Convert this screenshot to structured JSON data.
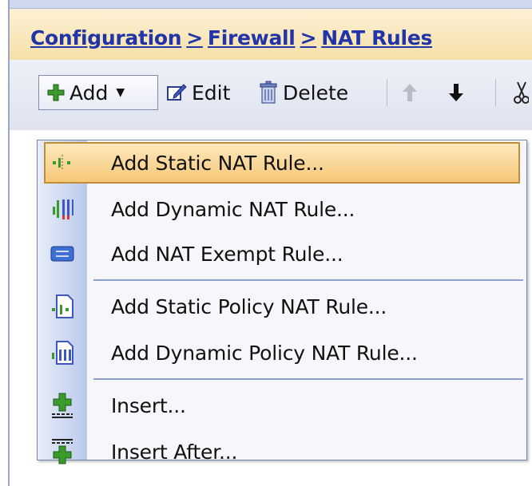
{
  "breadcrumb": [
    "Configuration",
    "Firewall",
    "NAT Rules"
  ],
  "breadcrumb_sep": ">",
  "toolbar": {
    "add_label": "Add",
    "edit_label": "Edit",
    "delete_label": "Delete"
  },
  "menu": {
    "items": [
      {
        "label": "Add Static NAT Rule...",
        "icon": "static-nat-icon",
        "highlighted": true
      },
      {
        "label": "Add Dynamic NAT Rule...",
        "icon": "dynamic-nat-icon"
      },
      {
        "label": "Add NAT Exempt Rule...",
        "icon": "nat-exempt-icon"
      },
      {
        "label": "Add Static Policy NAT Rule...",
        "icon": "static-policy-nat-icon"
      },
      {
        "label": "Add Dynamic Policy NAT Rule...",
        "icon": "dynamic-policy-nat-icon"
      },
      {
        "label": "Insert...",
        "icon": "insert-icon"
      },
      {
        "label": "Insert After...",
        "icon": "insert-after-icon"
      }
    ]
  },
  "colors": {
    "breadcrumb": "#2134a8",
    "header_bg": "#f6dfa9",
    "highlight": "#f6c777",
    "highlight_border": "#bf8e3a",
    "menu_gutter": "#b9c9ea"
  }
}
